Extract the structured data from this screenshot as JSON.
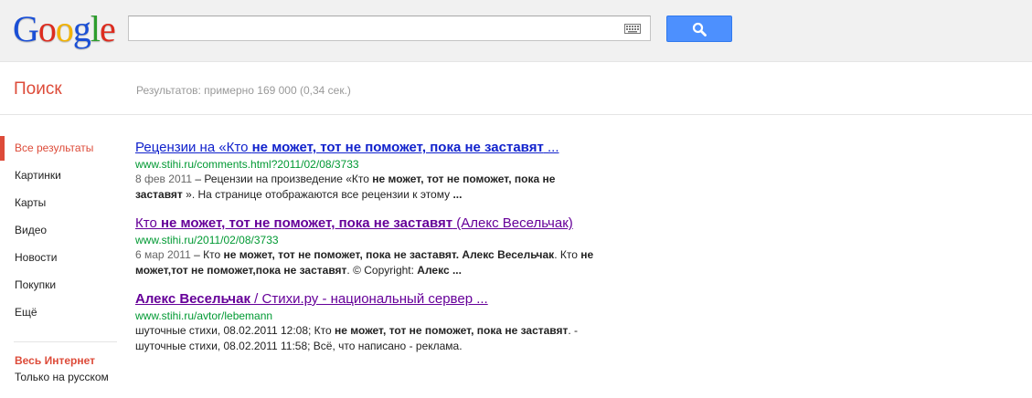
{
  "header": {
    "logo_letters": [
      "G",
      "o",
      "o",
      "g",
      "l",
      "e"
    ],
    "logo_colors": [
      "#1a4fd6",
      "#dd2c1f",
      "#f2b200",
      "#1a4fd6",
      "#2d9d2d",
      "#dd2c1f"
    ],
    "search_value": "",
    "accent": "#4d90fe"
  },
  "subheader": {
    "section_title": "Поиск",
    "result_stats": "Результатов: примерно 169 000 (0,34 сек.)"
  },
  "sidebar": {
    "items": [
      {
        "label": "Все результаты",
        "active": true
      },
      {
        "label": "Картинки"
      },
      {
        "label": "Карты"
      },
      {
        "label": "Видео"
      },
      {
        "label": "Новости"
      },
      {
        "label": "Покупки"
      },
      {
        "label": "Ещё"
      }
    ],
    "filter_active": "Весь Интернет",
    "filter_other": "Только на русском"
  },
  "results": [
    {
      "title_a": "Рецензии на «Кто ",
      "title_b": "не может, тот не поможет, пока не заставят",
      "title_c": " ...",
      "url": "www.stihi.ru/comments.html?2011/02/08/3733",
      "date": "8 фев 2011",
      "s1": " – Рецензии на произведение «Кто ",
      "s2": "не может, тот не поможет, пока не заставят",
      "s3": " ». На странице отображаются все рецензии к этому ",
      "s4": "..."
    },
    {
      "title_a": "Кто ",
      "title_b": "не может, тот не поможет, пока не заставят",
      "title_c": " (Алекс Весельчак)",
      "url": "www.stihi.ru/2011/02/08/3733",
      "date": "6 мар 2011",
      "s1": " – Кто ",
      "s2": "не может, тот не поможет, пока не заставят. Алекс Весельчак",
      "s3": ". Кто ",
      "s4": "не может,тот не поможет,пока не заставят",
      "s5": ". © Copyright: ",
      "s6": "Алекс ...",
      "s7": ""
    },
    {
      "title_a": "Алекс Весельчак",
      "title_b": " / Стихи.ру - национальный сервер ...",
      "url": "www.stihi.ru/avtor/lebemann",
      "s1": "шуточные стихи, 08.02.2011 12:08; Кто ",
      "s2": "не может, тот не поможет, пока не заставят",
      "s3": ". - шуточные стихи, 08.02.2011 11:58; Всё, что написано - реклама."
    }
  ]
}
